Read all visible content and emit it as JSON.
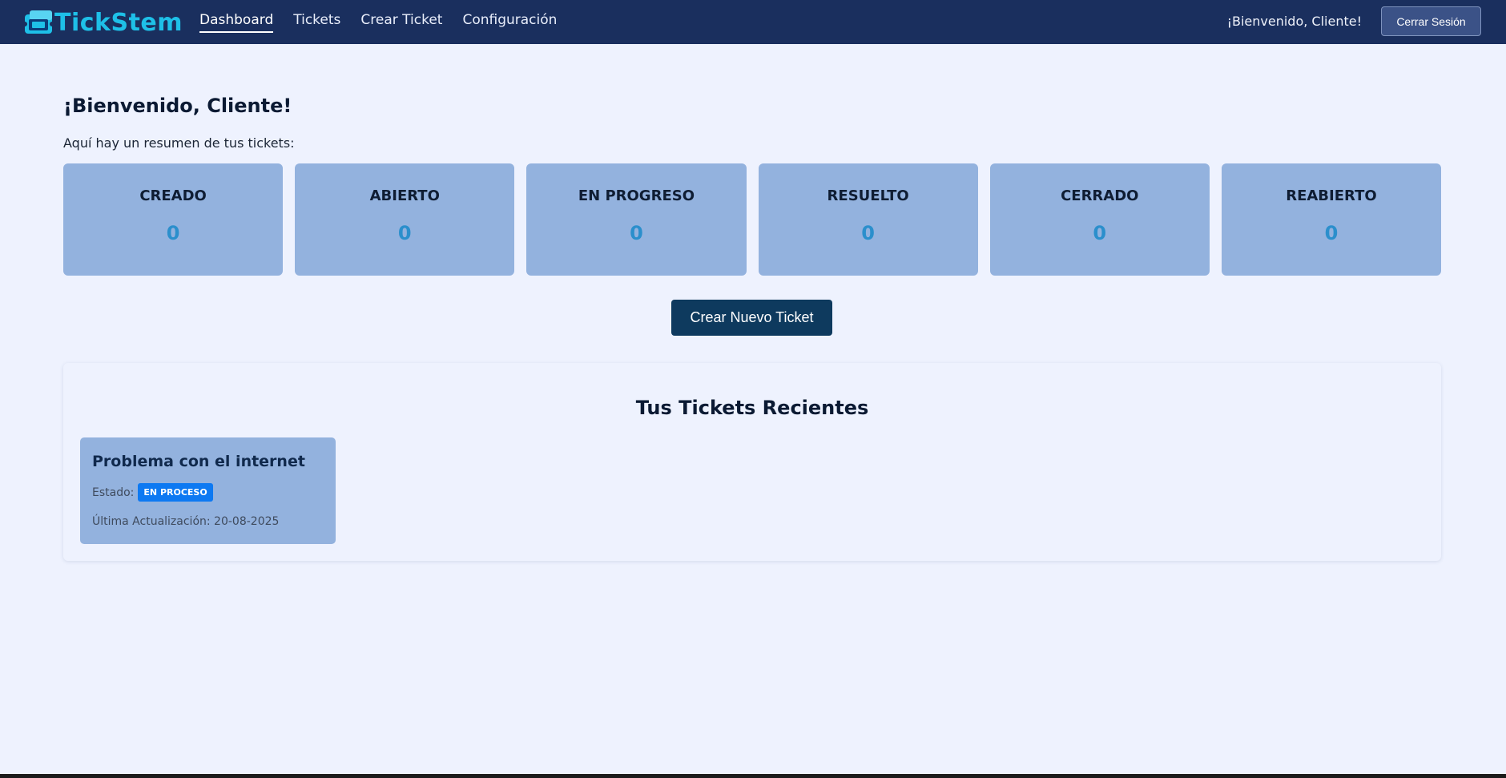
{
  "brand": {
    "name": "TickStem",
    "color": "#1ec0e8"
  },
  "nav": {
    "items": [
      {
        "label": "Dashboard",
        "active": true
      },
      {
        "label": "Tickets",
        "active": false
      },
      {
        "label": "Crear Ticket",
        "active": false
      },
      {
        "label": "Configuración",
        "active": false
      }
    ],
    "welcome": "¡Bienvenido, Cliente!",
    "logout_label": "Cerrar Sesión"
  },
  "main": {
    "title": "¡Bienvenido, Cliente!",
    "summary": "Aquí hay un resumen de tus tickets:",
    "stats": [
      {
        "label": "CREADO",
        "value": "0"
      },
      {
        "label": "ABIERTO",
        "value": "0"
      },
      {
        "label": "EN PROGRESO",
        "value": "0"
      },
      {
        "label": "RESUELTO",
        "value": "0"
      },
      {
        "label": "CERRADO",
        "value": "0"
      },
      {
        "label": "REABIERTO",
        "value": "0"
      }
    ],
    "create_button": "Crear Nuevo Ticket",
    "recent": {
      "title": "Tus Tickets Recientes",
      "tickets": [
        {
          "title": "Problema con el internet",
          "estado_label": "Estado:",
          "status": "EN PROCESO",
          "updated": "Última Actualización: 20-08-2025"
        }
      ]
    }
  },
  "colors": {
    "navbar": "#1a2f5e",
    "background": "#eef2fe",
    "card": "#93b2de",
    "stat_value": "#2b8fcc",
    "primary_button": "#0e3a5e",
    "status_badge": "#0d79f2"
  },
  "icons": {
    "brand_logo": "ticket-icon"
  }
}
